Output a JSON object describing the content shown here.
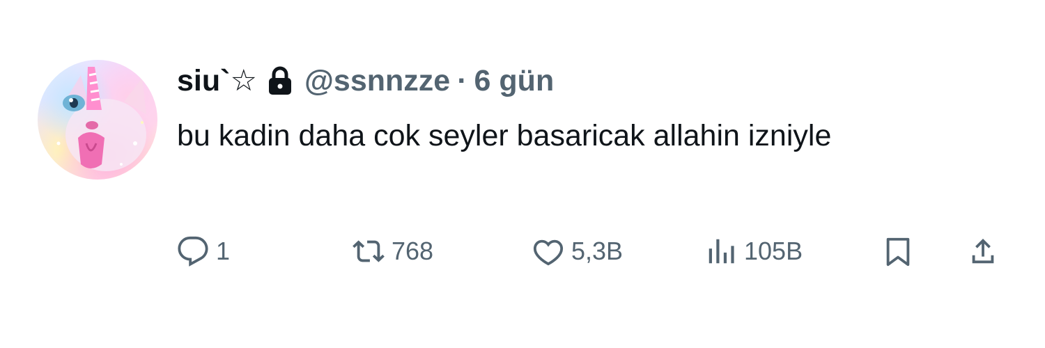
{
  "user": {
    "display_name": "siu`☆",
    "handle": "@ssnnzze",
    "separator": "·",
    "time": "6 gün",
    "protected": true
  },
  "tweet": {
    "text": "bu kadin daha cok seyler basaricak allahin izniyle"
  },
  "actions": {
    "replies": "1",
    "retweets": "768",
    "likes": "5,3B",
    "views": "105B"
  },
  "icons": {
    "avatar": "unicorn-cat-avatar",
    "lock": "lock-icon",
    "reply": "reply-icon",
    "retweet": "retweet-icon",
    "like": "heart-icon",
    "views": "views-icon",
    "bookmark": "bookmark-icon",
    "share": "share-icon"
  },
  "colors": {
    "text_primary": "#0f1419",
    "text_secondary": "#536471",
    "background": "#ffffff"
  }
}
